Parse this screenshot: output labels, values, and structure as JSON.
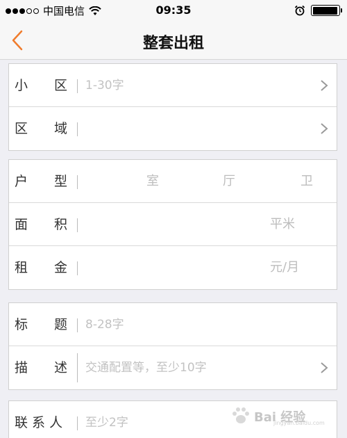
{
  "status_bar": {
    "carrier": "中国电信",
    "time": "09:35",
    "battery_level": 0.95
  },
  "nav": {
    "title": "整套出租",
    "back_icon": "chevron-left-icon",
    "accent_color": "#f07c2c"
  },
  "groups": [
    {
      "rows": [
        {
          "label": "小　　区",
          "placeholder": "1-30字",
          "chevron": true
        },
        {
          "label": "区　　域",
          "placeholder": "",
          "chevron": true
        }
      ]
    },
    {
      "rows": [
        {
          "label": "户　　型",
          "units": [
            "室",
            "厅",
            "卫"
          ]
        },
        {
          "label": "面　　积",
          "unit": "平米"
        },
        {
          "label": "租　　金",
          "unit": "元/月"
        }
      ]
    },
    {
      "rows": [
        {
          "label": "标　　题",
          "placeholder": "8-28字"
        },
        {
          "label": "描　　述",
          "placeholder": "交通配置等，至少10字",
          "chevron": true
        }
      ]
    },
    {
      "rows": [
        {
          "label": "联 系 人",
          "placeholder": "至少2字"
        }
      ]
    }
  ],
  "watermark": {
    "text": "Bai 经验",
    "sub": "jingyan.baidu.com"
  }
}
